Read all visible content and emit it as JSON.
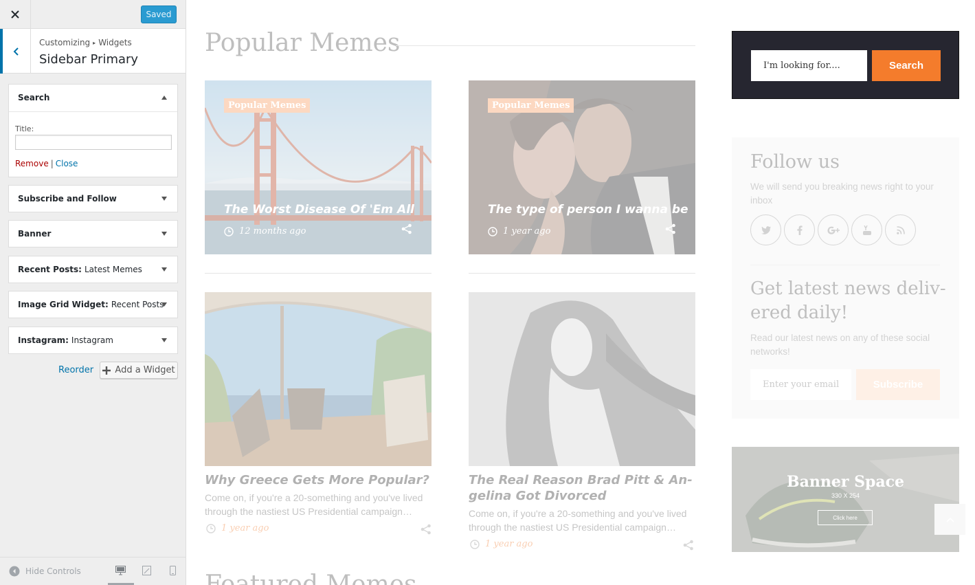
{
  "customizer": {
    "close_icon": "close-icon",
    "save_button": "Saved",
    "breadcrumb": [
      "Customizing",
      "Widgets"
    ],
    "section_title": "Sidebar Primary",
    "widgets": [
      {
        "title": "Search",
        "subtitle": "",
        "expanded": true
      },
      {
        "title": "Subscribe and Follow",
        "subtitle": ""
      },
      {
        "title": "Banner",
        "subtitle": ""
      },
      {
        "title": "Recent Posts:",
        "subtitle": "Latest Memes"
      },
      {
        "title": "Image Grid Widget:",
        "subtitle": "Recent Posts"
      },
      {
        "title": "Instagram:",
        "subtitle": "Instagram"
      }
    ],
    "search_widget": {
      "title_label": "Title:",
      "title_value": "",
      "remove": "Remove",
      "separator": "|",
      "close": "Close"
    },
    "reorder": "Reorder",
    "add_widget": "Add a Widget",
    "hide_controls": "Hide Controls",
    "devices": [
      "desktop",
      "tablet",
      "mobile"
    ],
    "active_device": "desktop",
    "accent_color": "#0073aa",
    "saved_color": "#2a9bd1"
  },
  "preview": {
    "section_title": "Popular Memes",
    "featured_cards": [
      {
        "badge": "Popular Memes",
        "title": "The Worst Disease Of 'Em All",
        "date": "12 months ago",
        "image": "golden-gate-bridge"
      },
      {
        "badge": "Popular Memes",
        "title": "The type of person I wanna be",
        "date": "1 year ago",
        "image": "couple-embrace"
      }
    ],
    "posts": [
      {
        "title": "Why Greece Gets More Popular?",
        "excerpt": "Come on, if you're a 20-something and you've lived through the nastiest US Presidential campaign…",
        "date": "1 year ago",
        "image": "beach-umbrella-chairs"
      },
      {
        "title": "The Real Reason Brad Pitt & Angelina Got Divorced",
        "title_line1": "The Real Reason Brad Pitt & An-",
        "title_line2": "gelina Got Divorced",
        "excerpt": "Come on, if you're a 20-something and you've lived through the nastiest US Presidential campaign…",
        "date": "1 year ago",
        "image": "woman-flowing-hair"
      }
    ],
    "next_section_title": "Featured Memes",
    "search_widget": {
      "placeholder": "I'm looking for....",
      "button": "Search"
    },
    "follow_widget": {
      "title": "Follow us",
      "text": "We will send you breaking news right to your inbox",
      "social_icons": [
        "twitter-icon",
        "facebook-icon",
        "google-plus-icon",
        "youtube-icon",
        "rss-icon"
      ],
      "news_title": "Get latest news delivered daily!",
      "news_title_line1": "Get latest news deliv-",
      "news_title_line2": "ered daily!",
      "news_text": "Read our latest news on any of these social networks!",
      "email_placeholder": "Enter your email",
      "subscribe_button": "Subscribe"
    },
    "banner": {
      "title": "Banner Space",
      "size": "330 X 254",
      "button": "Click here"
    },
    "accent_color": "#f47c2c"
  }
}
